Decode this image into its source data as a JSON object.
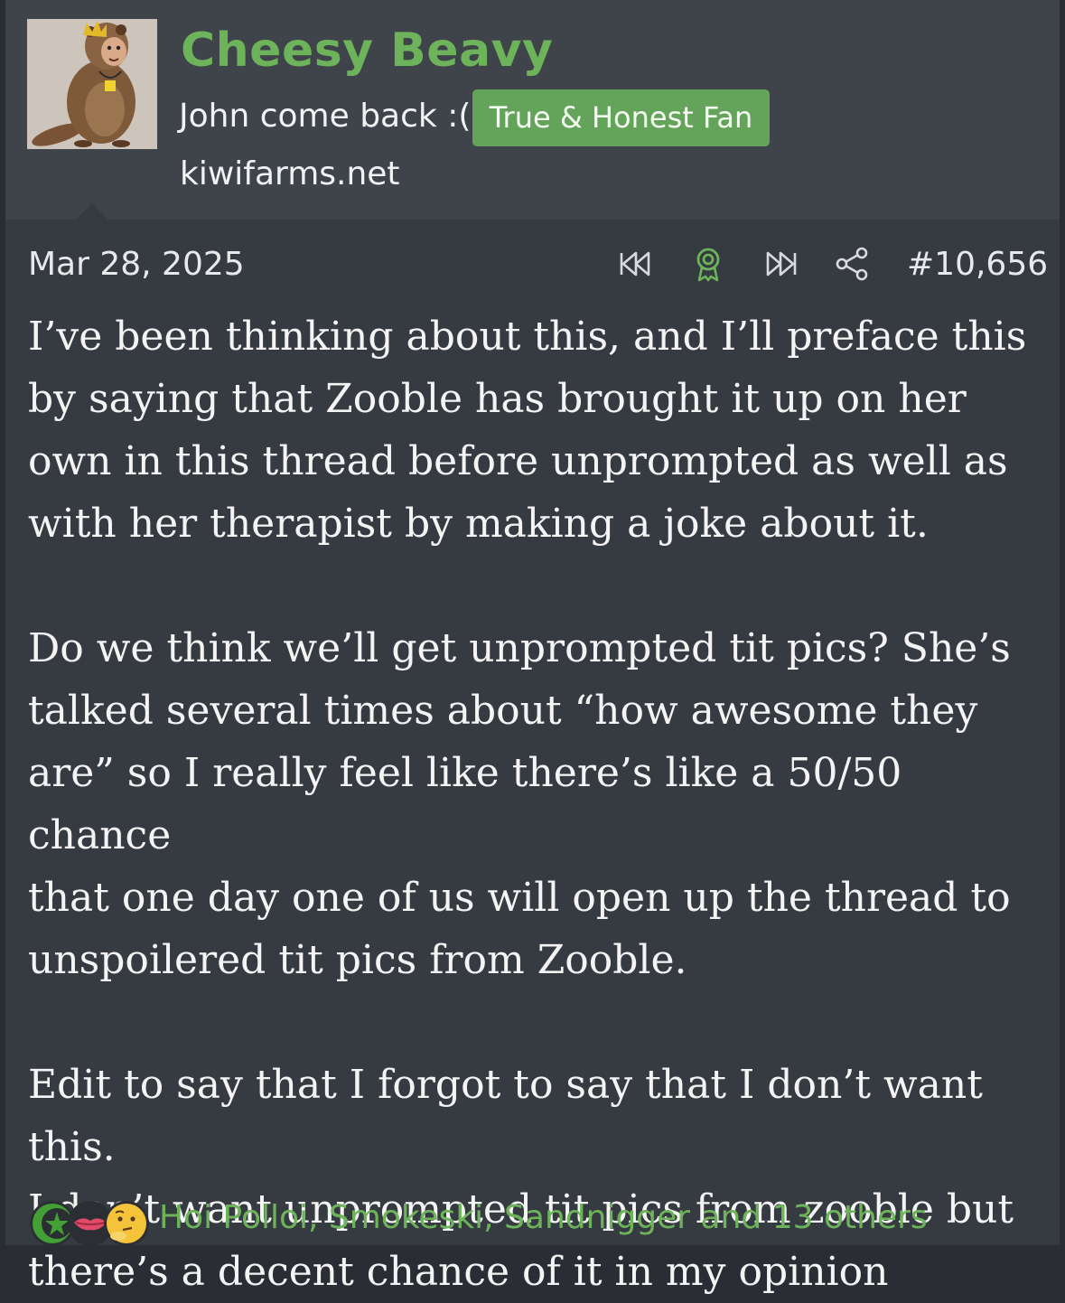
{
  "user": {
    "name": "Cheesy Beavy",
    "title": "John come back :(",
    "badge": "True & Honest Fan",
    "site": "kiwifarms.net"
  },
  "post": {
    "date": "Mar 28, 2025",
    "number": "#10,656",
    "paragraphs": [
      [
        "I’ve been thinking about this, and I’ll preface this",
        "by saying that Zooble has brought it up on her",
        "own in this thread before unprompted as well as",
        "with her therapist by making a joke about it."
      ],
      [
        "Do we think we’ll get unprompted tit pics? She’s",
        "talked several times about “how awesome they",
        "are” so I really feel like there’s like a 50/50 chance",
        "that one day one of us will open up the thread to",
        "unspoilered tit pics from Zooble."
      ],
      [
        "Edit to say that I forgot to say that I don’t want this.",
        "I don’t want unprompted tit pics from zooble but",
        "there’s a decent chance of it in my opinion"
      ]
    ]
  },
  "actions": [
    "rewind-icon",
    "award-icon",
    "fast-forward-icon",
    "share-icon"
  ],
  "reactions": {
    "icons": [
      "star-crescent-icon",
      "lips-icon",
      "thinking-face-icon"
    ],
    "text": "Hoi Polloi, Smokeski, Sandnigger and 13 others"
  },
  "colors": {
    "accent": "#6db35a",
    "badge": "#63a45a",
    "header_bg": "#3f444b",
    "body_bg": "#363a41",
    "text": "#f4f4f4"
  }
}
